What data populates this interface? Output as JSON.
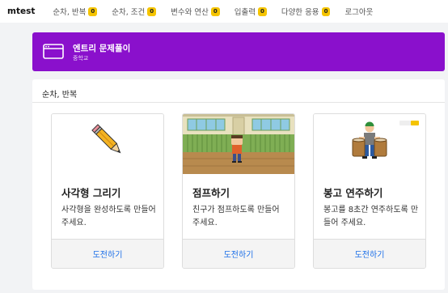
{
  "navbar": {
    "brand": "mtest",
    "items": [
      {
        "label": "순차, 반복",
        "badge": "0"
      },
      {
        "label": "순차, 조건",
        "badge": "0"
      },
      {
        "label": "변수와 연산",
        "badge": "0"
      },
      {
        "label": "입출력",
        "badge": "0"
      },
      {
        "label": "다양한 응용",
        "badge": "0"
      },
      {
        "label": "로그아웃"
      }
    ]
  },
  "banner": {
    "title": "엔트리 문제풀이",
    "subtitle": "중학교",
    "icon": "window-icon",
    "color": "#8a10cc"
  },
  "section": {
    "title": "순차, 반복"
  },
  "cards": [
    {
      "title": "사각형 그리기",
      "description": "사각형을 완성하도록 만들어 주세요.",
      "button": "도전하기",
      "thumbnail": "pencil"
    },
    {
      "title": "점프하기",
      "description": "친구가 점프하도록 만들어 주세요.",
      "button": "도전하기",
      "thumbnail": "classroom-student"
    },
    {
      "title": "봉고 연주하기",
      "description": "봉고를 8초간 연주하도록 만들어 주세요.",
      "button": "도전하기",
      "thumbnail": "bongo-player"
    }
  ],
  "colors": {
    "accent": "#8a10cc",
    "link": "#1a6ee8",
    "badge": "#f5c400"
  }
}
